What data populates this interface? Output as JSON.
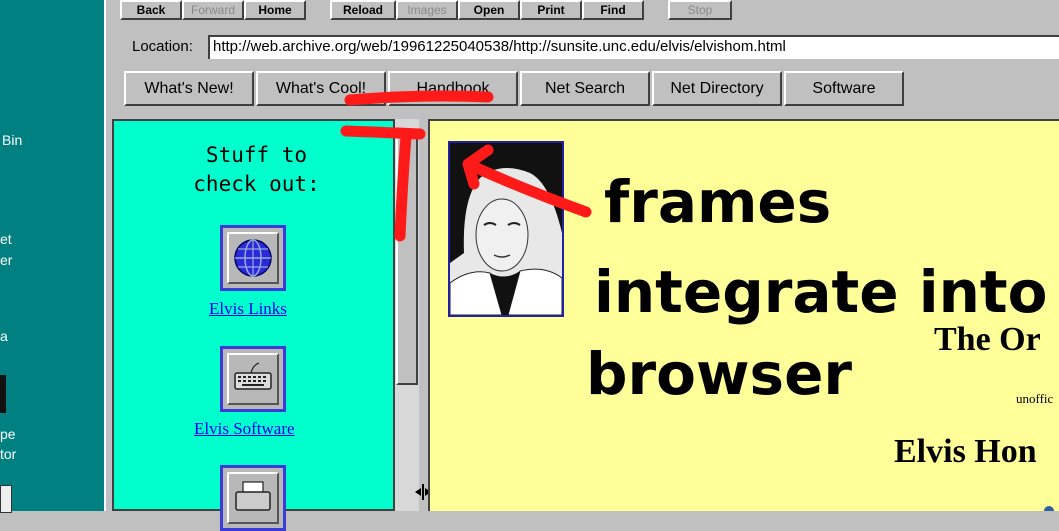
{
  "desktop": {
    "labels": [
      "Bin",
      "et",
      "er",
      "a",
      "pe",
      "tor"
    ]
  },
  "toolbar": {
    "back": "Back",
    "forward": "Forward",
    "home": "Home",
    "reload": "Reload",
    "images": "Images",
    "open": "Open",
    "print": "Print",
    "find": "Find",
    "stop": "Stop"
  },
  "location": {
    "label": "Location:",
    "url": "http://web.archive.org/web/19961225040538/http://sunsite.unc.edu/elvis/elvishom.html"
  },
  "directory": {
    "whats_new": "What's New!",
    "whats_cool": "What's Cool!",
    "handbook": "Handbook",
    "net_search": "Net Search",
    "net_directory": "Net Directory",
    "software": "Software"
  },
  "left_frame": {
    "heading_line1": "Stuff to",
    "heading_line2": "check out:",
    "links": [
      "Elvis Links",
      "Elvis Software"
    ]
  },
  "right_frame": {
    "title_partial": "The Or",
    "subtitle_partial": "unoffic",
    "heading_partial": "Elvis Hon"
  },
  "annotation": {
    "line1": "frames",
    "line2": "integrate into",
    "line3": "browser",
    "color": "#ff1a1a"
  }
}
